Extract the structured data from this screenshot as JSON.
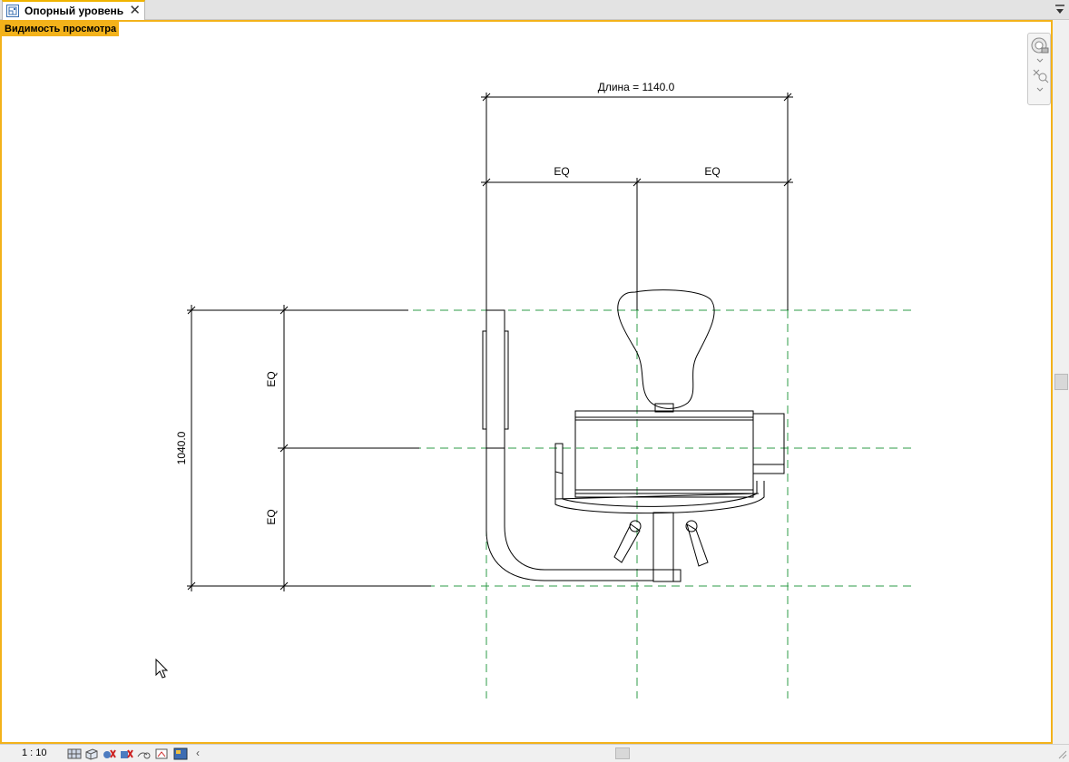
{
  "tab": {
    "title": "Опорный уровень",
    "close_glyph": "🗙",
    "icon": "floor-plan-icon"
  },
  "view": {
    "label": "Видимость просмотра"
  },
  "dimensions": {
    "length_label": "Длина = 1140.0",
    "top_left_eq": "EQ",
    "top_right_eq": "EQ",
    "vertical_total": "1040.0",
    "vertical_upper_eq": "EQ",
    "vertical_lower_eq": "EQ"
  },
  "colors": {
    "reference_plane": "#2e9b47",
    "active_border": "#f3b21a",
    "linework": "#000000"
  },
  "statusbar": {
    "scale": "1 : 10",
    "icons": [
      "detail-level-icon",
      "visual-style-icon",
      "sun-path-icon",
      "shadows-icon",
      "crop-view-icon",
      "show-crop-icon",
      "temporary-hide-icon"
    ]
  }
}
